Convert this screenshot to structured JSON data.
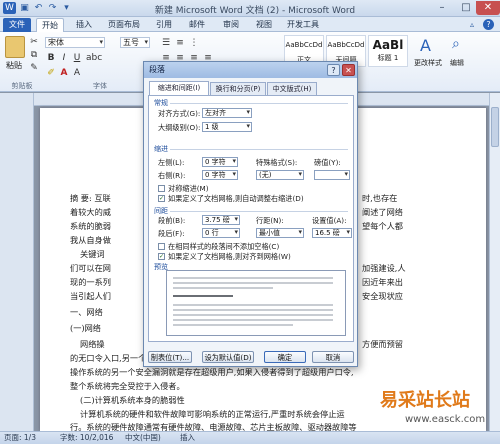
{
  "window": {
    "title": "新建 Microsoft Word 文档 (2) - Microsoft Word"
  },
  "quick_access": [
    "save-icon",
    "undo-icon",
    "redo-icon"
  ],
  "ribbon_tabs": [
    "文件",
    "开始",
    "插入",
    "页面布局",
    "引用",
    "邮件",
    "审阅",
    "视图",
    "开发工具"
  ],
  "ribbon": {
    "paste": "粘贴",
    "clipboard": "剪贴板",
    "font_name": "宋体",
    "font_size": "五号",
    "font_group": "字体",
    "styles": [
      {
        "sample": "AaBbCcDd",
        "label": "正文"
      },
      {
        "sample": "AaBbCcDd",
        "label": "无间隔"
      },
      {
        "sample": "AaBl",
        "label": "标题 1"
      }
    ],
    "change_styles": "更改样式",
    "editing": "编辑"
  },
  "document": {
    "lines": [
      "摘 要: 互联",
      "着较大的威",
      "系统的脆弱",
      "我从自身做",
      "关键词",
      "一、网络",
      "(一)网络",
      "网络操",
      "的无口令入口,另一个是隐藏的后门,一般是系统开发时专门维护的通道,再者,",
      "操作系统的另一个安全漏洞就是存在超级用户,如果入侵者得到了超级用户口令,",
      "整个系统将完全受控于入侵者。",
      "(二)计算机系统本身的脆弱性",
      "计算机系统的硬件和软件故障可影响系统的正常运行,严重时系统会停止运",
      "行。系统的硬件故障通常有硬件故障、电源故障、芯片主板故障、驱动器故障等"
    ],
    "right_fragments": [
      "时,也存在",
      "阐述了网络",
      "望每个人都",
      "加强建设,人",
      "因近年来出",
      "安全现状应",
      "方便而预留"
    ],
    "left_fragments": [
      "们可以在网",
      "现的一系列",
      "当引起人们"
    ]
  },
  "status_bar": {
    "page": "页面: 1/3",
    "words": "字数: 10/2,016",
    "language": "中文(中国)",
    "mode": "插入"
  },
  "dialog": {
    "title": "段落",
    "tabs": [
      "缩进和间距(I)",
      "换行和分页(P)",
      "中文版式(H)"
    ],
    "general": {
      "heading": "常规",
      "align_label": "对齐方式(G):",
      "align_value": "左对齐",
      "outline_label": "大纲级别(O):",
      "outline_value": "1 级"
    },
    "indent": {
      "heading": "缩进",
      "left_label": "左侧(L):",
      "left_value": "0 字符",
      "right_label": "右侧(R):",
      "right_value": "0 字符",
      "special_label": "特殊格式(S):",
      "special_value": "(无)",
      "by_label": "磅值(Y):",
      "by_value": "",
      "mirror": "对称缩进(M)",
      "mirror_checked": false,
      "auto_adjust": "如果定义了文档网格,则自动调整右缩进(D)",
      "auto_adjust_checked": true
    },
    "spacing": {
      "heading": "间距",
      "before_label": "段前(B):",
      "before_value": "3.75 磅",
      "after_label": "段后(F):",
      "after_value": "0 行",
      "line_label": "行距(N):",
      "line_value": "最小值",
      "at_label": "设置值(A):",
      "at_value": "16.5 磅",
      "no_space": "在相同样式的段落间不添加空格(C)",
      "no_space_checked": false,
      "snap_grid": "如果定义了文档网格,则对齐到网格(W)",
      "snap_grid_checked": true
    },
    "preview": {
      "heading": "预览"
    },
    "buttons": {
      "tabs": "制表位(T)...",
      "default": "设为默认值(D)",
      "ok": "确定",
      "cancel": "取消"
    }
  },
  "watermark": {
    "text": "易采站长站",
    "url": "www.easck.com"
  },
  "colors": {
    "file_tab": "#2a62b8",
    "dialog_title": "#9ebbe3",
    "watermark": "#e07a1a"
  }
}
